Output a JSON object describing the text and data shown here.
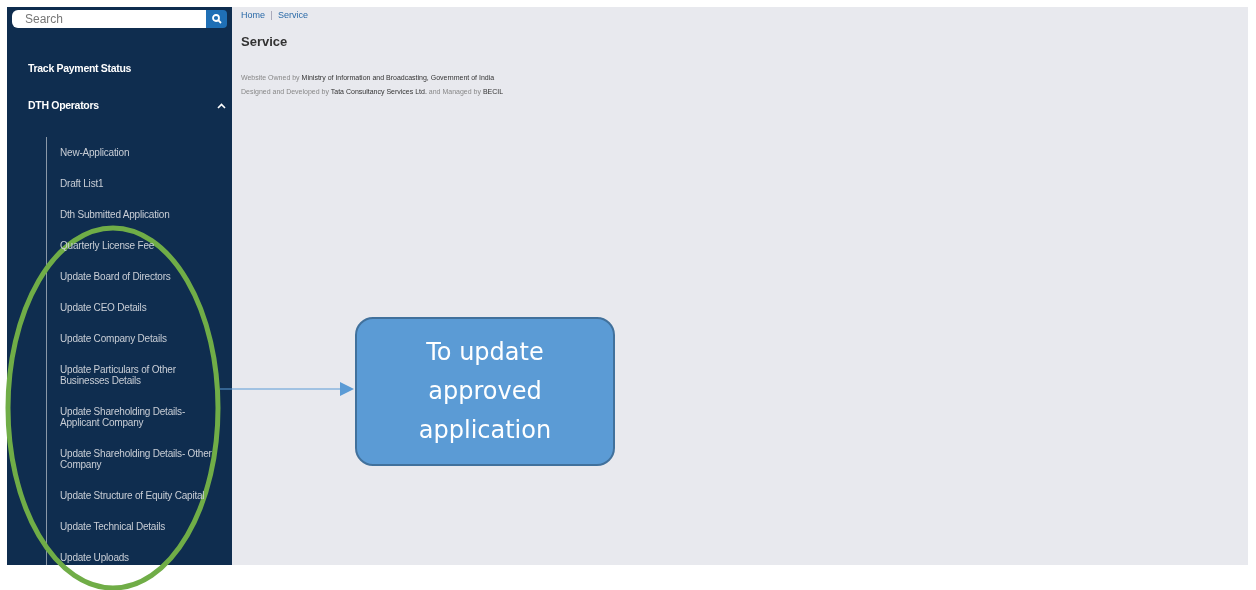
{
  "sidebar": {
    "search": {
      "placeholder": "Search"
    },
    "items": [
      {
        "label": "Track Payment Status",
        "kind": "link"
      },
      {
        "label": "DTH Operators",
        "kind": "group",
        "expanded": true,
        "children": [
          {
            "label": "New-Application"
          },
          {
            "label": "Draft List1"
          },
          {
            "label": "Dth Submitted Application"
          },
          {
            "label": "Quarterly License Fee"
          },
          {
            "label": "Update Board of Directors"
          },
          {
            "label": "Update CEO Details"
          },
          {
            "label": "Update Company Details"
          },
          {
            "label": "Update Particulars of Other Businesses Details"
          },
          {
            "label": "Update Shareholding Details- Applicant Company"
          },
          {
            "label": "Update Shareholding Details- Other Company"
          },
          {
            "label": "Update Structure of Equity Capital"
          },
          {
            "label": "Update Technical Details"
          },
          {
            "label": "Update Uploads"
          }
        ]
      }
    ]
  },
  "breadcrumb": [
    "Home",
    "Service"
  ],
  "page_title": "Service",
  "footer": [
    "Website Owned by **Ministry of Information and Broadcasting, Government of India**",
    "Designed and Developed by **Tata Consultancy Services Ltd.** and Managed by **BECIL**"
  ],
  "annotation": {
    "callout": "To update approved application"
  }
}
